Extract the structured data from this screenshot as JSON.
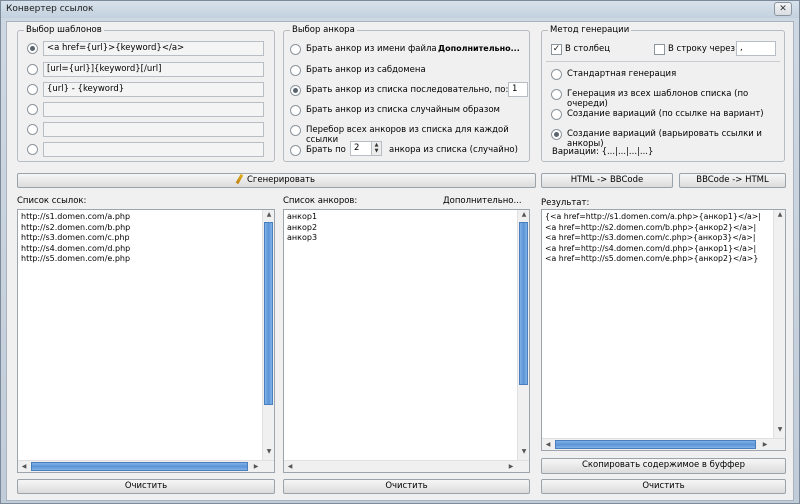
{
  "window": {
    "title": "Конвертер ссылок",
    "close_icon": "✕"
  },
  "templates": {
    "title": "Выбор шаблонов",
    "items": [
      "<a href={url}>{keyword}</a>",
      "[url={url}]{keyword}[/url]",
      "{url} - {keyword}",
      "",
      "",
      ""
    ]
  },
  "anchor": {
    "title": "Выбор анкора",
    "from_filename": "Брать анкор из имени файла",
    "more": "Дополнительно...",
    "from_subdomain": "Брать анкор из сабдомена",
    "from_list_seq": "Брать анкор из списка  последовательно, по:",
    "seq_value": "1",
    "from_list_random": "Брать анкор из списка случайным образом",
    "iterate_all": "Перебор всех анкоров из списка для каждой ссылки",
    "take_by_prefix": "Брать по",
    "take_by_value": "2",
    "take_by_suffix": "анкора из списка (случайно)"
  },
  "method": {
    "title": "Метод генерации",
    "column": "В столбец",
    "row": "В строку через",
    "row_sep": ",",
    "standard": "Стандартная генерация",
    "all_templates": "Генерация из всех шаблонов списка (по очереди)",
    "variations_per_link": "Создание вариаций (по ссылке на вариант)",
    "variations_vary": "Создание вариаций (варьировать ссылки и анкоры)",
    "variations_label": "Вариации: {...|...|...|...}"
  },
  "buttons": {
    "generate": "Сгенерировать",
    "html_to_bbcode": "HTML -> BBCode",
    "bbcode_to_html": "BBCode -> HTML",
    "clear": "Очистить",
    "copy": "Скопировать содержимое в буффер"
  },
  "links": {
    "label": "Список ссылок:",
    "text": "http://s1.domen.com/a.php\nhttp://s2.domen.com/b.php\nhttp://s3.domen.com/c.php\nhttp://s4.domen.com/d.php\nhttp://s5.domen.com/e.php"
  },
  "anchors": {
    "label": "Список анкоров:",
    "more": "Дополнительно...",
    "text": "анкор1\nанкор2\nанкор3"
  },
  "result": {
    "label": "Результат:",
    "text": "{<a href=http://s1.domen.com/a.php>{анкор1}</a>|\n<a href=http://s2.domen.com/b.php>{анкор2}</a>|\n<a href=http://s3.domen.com/c.php>{анкор3}</a>|\n<a href=http://s4.domen.com/d.php>{анкор1}</a>|\n<a href=http://s5.domen.com/e.php>{анкор2}</a>}"
  }
}
